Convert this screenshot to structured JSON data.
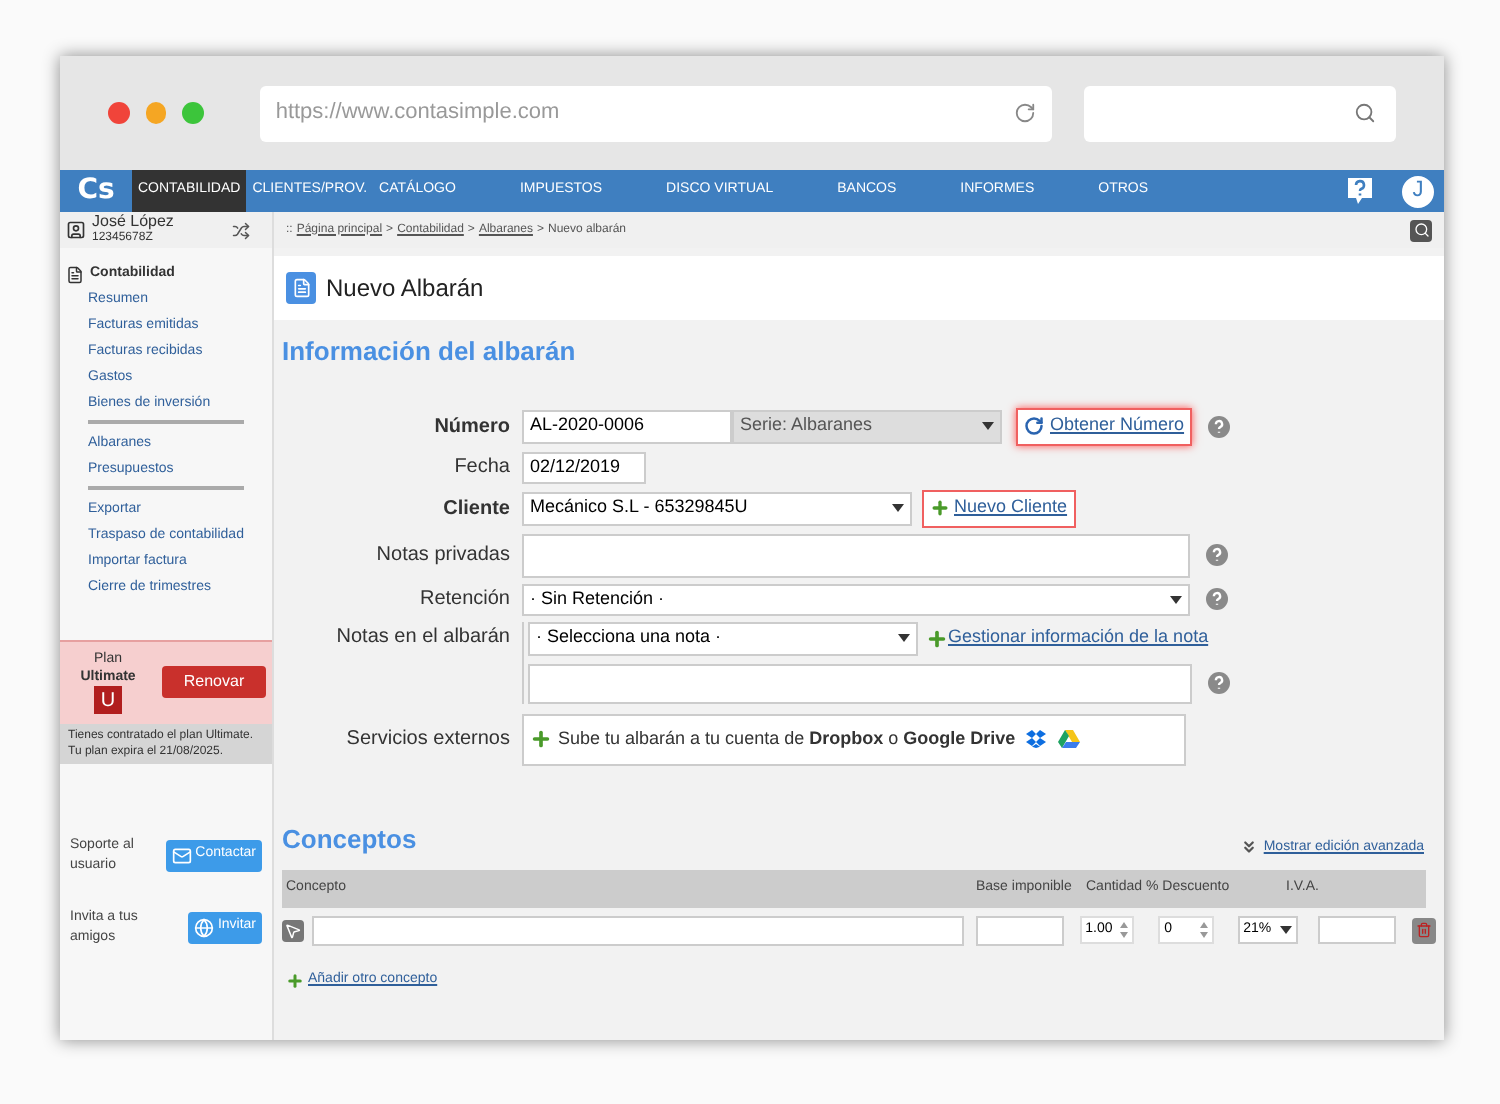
{
  "browser": {
    "url": "https://www.contasimple.com"
  },
  "nav": {
    "logo": "Cs",
    "items": [
      {
        "label": "CONTABILIDAD",
        "selected": true
      },
      {
        "label": "CLIENTES/PROV.",
        "selected": false
      },
      {
        "label": "CATÁLOGO",
        "selected": false
      },
      {
        "label": "IMPUESTOS",
        "selected": false
      },
      {
        "label": "DISCO VIRTUAL",
        "selected": false
      },
      {
        "label": "BANCOS",
        "selected": false
      },
      {
        "label": "INFORMES",
        "selected": false
      },
      {
        "label": "OTROS",
        "selected": false
      }
    ],
    "avatar": "J"
  },
  "user": {
    "name": "José López",
    "id": "12345678Z"
  },
  "breadcrumb": {
    "prefix": "::",
    "separator": ">",
    "items": [
      {
        "label": "Página principal",
        "link": true
      },
      {
        "label": "Contabilidad",
        "link": true
      },
      {
        "label": "Albaranes",
        "link": true
      },
      {
        "label": "Nuevo albarán",
        "link": false
      }
    ]
  },
  "sidebar": {
    "title": "Contabilidad",
    "groups": [
      [
        "Resumen",
        "Facturas emitidas",
        "Facturas recibidas",
        "Gastos",
        "Bienes de inversión"
      ],
      [
        "Albaranes",
        "Presupuestos"
      ],
      [
        "Exportar",
        "Traspaso de contabilidad",
        "Importar factura",
        "Cierre de trimestres"
      ]
    ]
  },
  "plan": {
    "label": "Plan",
    "name": "Ultimate",
    "badge": "U",
    "button": "Renovar",
    "note": "Tienes contratado el plan Ultimate. Tu plan expira el 21/08/2025."
  },
  "support": [
    {
      "text": "Soporte al usuario",
      "button": "Contactar",
      "kind": "mail"
    },
    {
      "text": "Invita a tus amigos",
      "button": "Invitar",
      "kind": "globe"
    }
  ],
  "page_title": "Nuevo Albarán",
  "section_title": "Información del albarán",
  "form": {
    "numero": {
      "label": "Número",
      "value": "AL-2020-0006",
      "serie": "Serie: Albaranes",
      "button": "Obtener Número"
    },
    "fecha": {
      "label": "Fecha",
      "value": "02/12/2019"
    },
    "cliente": {
      "label": "Cliente",
      "value": "Mecánico S.L - 65329845U",
      "button": "Nuevo Cliente"
    },
    "notas_privadas": {
      "label": "Notas privadas"
    },
    "retencion": {
      "label": "Retención",
      "value": "· Sin Retención ·"
    },
    "notas_albaran": {
      "label": "Notas en el albarán",
      "value": "· Selecciona una nota ·",
      "link": "Gestionar información de la nota"
    },
    "servicios": {
      "label": "Servicios externos",
      "text": "Sube tu albarán a tu cuenta de **Dropbox** o **Google Drive**"
    }
  },
  "conceptos": {
    "title": "Conceptos",
    "advanced_link": "Mostrar edición avanzada",
    "columns": [
      "Concepto",
      "Base imponible",
      "Cantidad",
      "% Descuento",
      "I.V.A."
    ],
    "row": {
      "cantidad": "1.00",
      "descuento": "0",
      "iva": "21%"
    },
    "add_link": "Añadir otro concepto"
  }
}
